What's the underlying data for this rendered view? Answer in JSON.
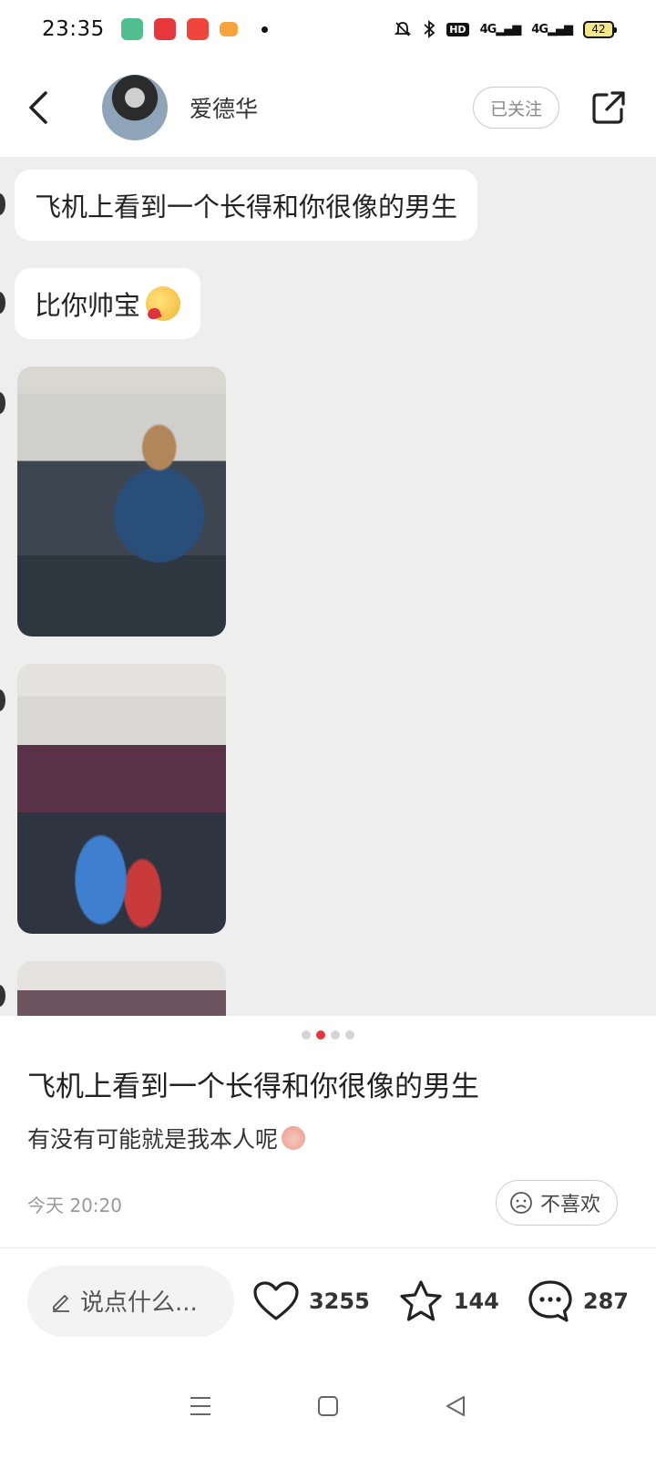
{
  "status_bar": {
    "time": "23:35",
    "hd_badge": "HD",
    "signal1": "4G",
    "signal2": "4G",
    "battery": "42"
  },
  "header": {
    "username": "爱德华",
    "follow_label": "已关注"
  },
  "content": {
    "bubble1": "飞机上看到一个长得和你很像的男生",
    "bubble2": "比你帅宝"
  },
  "carousel": {
    "total": 4,
    "active_index": 1
  },
  "post": {
    "title": "飞机上看到一个长得和你很像的男生",
    "body": "有没有可能就是我本人呢",
    "date": "今天 20:20",
    "dislike_label": "不喜欢"
  },
  "bottom_bar": {
    "comment_placeholder": "说点什么...",
    "likes": "3255",
    "favorites": "144",
    "comments": "287"
  },
  "colors": {
    "accent": "#e8363d",
    "background": "#eeeeee"
  }
}
